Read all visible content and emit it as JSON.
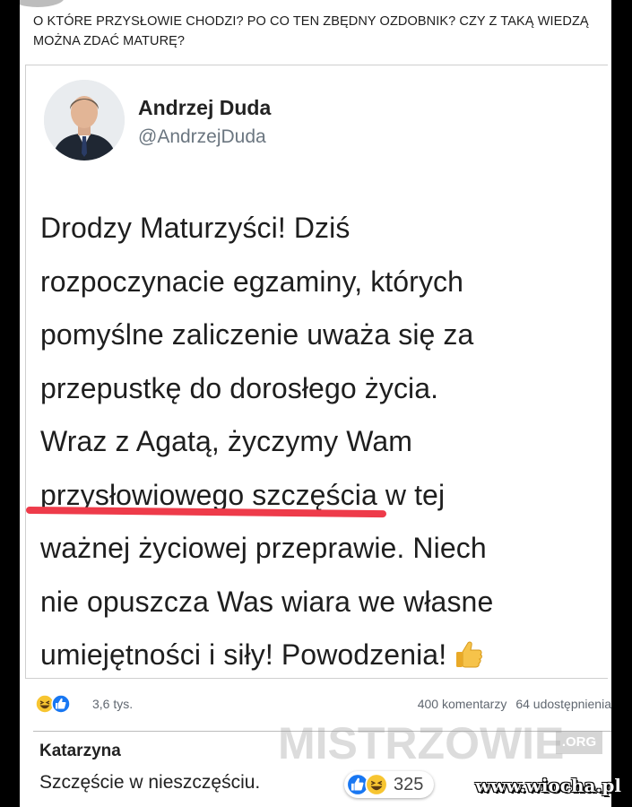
{
  "post": {
    "text": "O KTÓRE PRZYSŁOWIE CHODZI? PO CO TEN ZBĘDNY OZDOBNIK? CZY Z TAKĄ WIEDZĄ MOŻNA ZDAĆ MATURĘ?"
  },
  "tweet": {
    "author_name": "Andrzej Duda",
    "author_handle": "@AndrzejDuda",
    "lines": [
      "Drodzy Maturzyści! Dziś",
      "rozpoczynacie egzaminy, których",
      "pomyślne zaliczenie uważa się za",
      "przepustkę do dorosłego życia.",
      "Wraz z Agatą, życzymy Wam"
    ],
    "highlighted_phrase": "przysłowiowego szczęścia",
    "line6_rest": " w tej",
    "lines_after": [
      "ważnej życiowej przeprawie. Niech",
      "nie opuszcza Was wiara we własne"
    ],
    "last_line": "umiejętności i siły! Powodzenia!",
    "highlight_color": "#ee3b4a"
  },
  "reactions": {
    "count": "3,6 tys.",
    "comments": "400 komentarzy",
    "shares": "64 udostępnienia",
    "icons": [
      "laugh-reaction-icon",
      "like-reaction-icon"
    ]
  },
  "comment": {
    "author": "Katarzyna",
    "text": "Szczęście w nieszczęściu.",
    "reaction_count": "325",
    "icons": [
      "like-reaction-icon",
      "laugh-reaction-icon"
    ]
  },
  "watermark": {
    "text": "MISTRZOWIE",
    "suffix": ".ORG"
  },
  "source": {
    "text": "www.wiocha.pl"
  }
}
